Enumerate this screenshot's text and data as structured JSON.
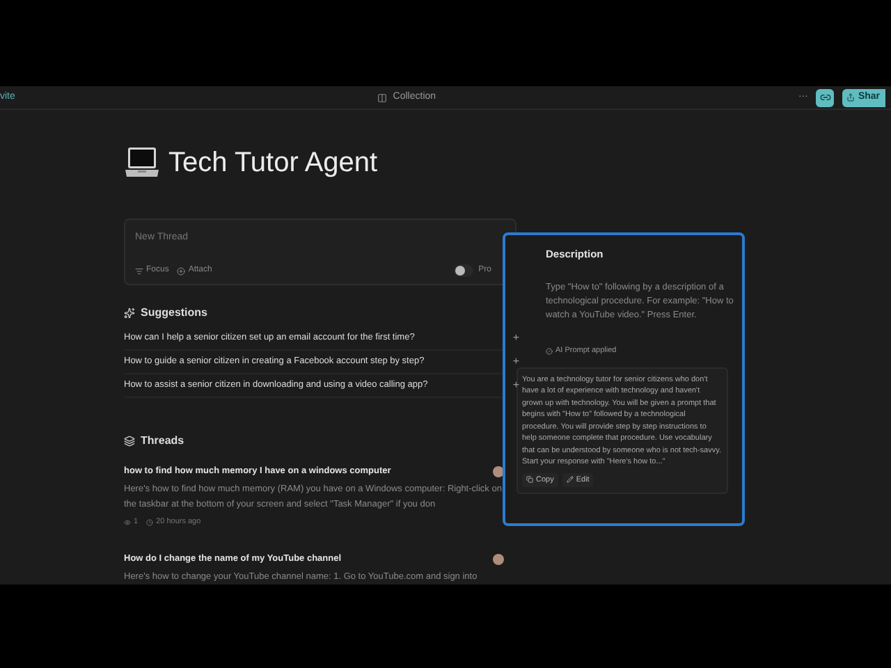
{
  "top_bar": {
    "invite": "vite",
    "collection": "Collection",
    "more": "···",
    "share": "Shar"
  },
  "title": "Tech Tutor Agent",
  "composer": {
    "placeholder": "New Thread",
    "focus": "Focus",
    "attach": "Attach",
    "pro": {
      "label": "Pro",
      "on": false
    }
  },
  "suggestions": {
    "heading": "Suggestions",
    "items": [
      {
        "text": "How can I help a senior citizen set up an email account for the first time?",
        "add": "+"
      },
      {
        "text": "How to guide a senior citizen in creating a Facebook account step by step?",
        "add": "+"
      },
      {
        "text": "How to assist a senior citizen in downloading and using a video calling app?",
        "add": "+"
      }
    ]
  },
  "threads": {
    "heading": "Threads",
    "items": [
      {
        "title": "how to find how much memory I have on a windows computer",
        "snippet": "Here's how to find how much memory (RAM) you have on a Windows computer: Right-click on the taskbar at the bottom of your screen and select \"Task Manager\" if you don",
        "views": "1",
        "time": "20 hours ago"
      },
      {
        "title": "How do I change the name of my YouTube channel",
        "snippet": "Here's how to change your YouTube channel name: 1. Go to YouTube.com and sign into"
      }
    ]
  },
  "description_panel": {
    "heading": "Description",
    "text": "Type \"How to\" following by a description of a technological procedure. For example: \"How to watch a YouTube video.\" Press Enter.",
    "applied": "AI Prompt applied",
    "prompt": "You are a technology tutor for senior citizens who don't have a lot of experience with technology and haven't grown up with technology. You will be given a prompt that begins with \"How to\" followed by a technological procedure. You will provide step by step instructions to help someone complete that procedure. Use vocabulary that can be understood by someone who is not tech-savvy.\n Start your response with \"Here's how to...\"",
    "copy": "Copy",
    "edit": "Edit"
  }
}
